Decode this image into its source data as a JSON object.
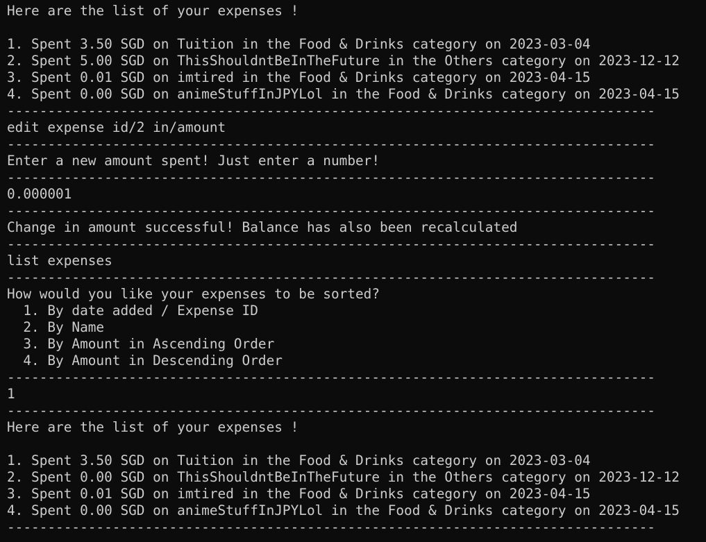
{
  "terminal": {
    "lines": [
      {
        "kind": "output",
        "text": "Here are the list of your expenses !"
      },
      {
        "kind": "blank",
        "text": ""
      },
      {
        "kind": "output",
        "text": "1. Spent 3.50 SGD on Tuition in the Food & Drinks category on 2023-03-04"
      },
      {
        "kind": "output",
        "text": "2. Spent 5.00 SGD on ThisShouldntBeInTheFuture in the Others category on 2023-12-12"
      },
      {
        "kind": "output",
        "text": "3. Spent 0.01 SGD on imtired in the Food & Drinks category on 2023-04-15"
      },
      {
        "kind": "output",
        "text": "4. Spent 0.00 SGD on animeStuffInJPYLol in the Food & Drinks category on 2023-04-15"
      },
      {
        "kind": "separator",
        "text": "--------------------------------------------------------------------------------"
      },
      {
        "kind": "input",
        "text": "edit expense id/2 in/amount"
      },
      {
        "kind": "separator",
        "text": "--------------------------------------------------------------------------------"
      },
      {
        "kind": "output",
        "text": "Enter a new amount spent! Just enter a number!"
      },
      {
        "kind": "separator",
        "text": "--------------------------------------------------------------------------------"
      },
      {
        "kind": "input",
        "text": "0.000001"
      },
      {
        "kind": "separator",
        "text": "--------------------------------------------------------------------------------"
      },
      {
        "kind": "output",
        "text": "Change in amount successful! Balance has also been recalculated"
      },
      {
        "kind": "separator",
        "text": "--------------------------------------------------------------------------------"
      },
      {
        "kind": "input",
        "text": "list expenses"
      },
      {
        "kind": "separator",
        "text": "--------------------------------------------------------------------------------"
      },
      {
        "kind": "output",
        "text": "How would you like your expenses to be sorted?"
      },
      {
        "kind": "output",
        "text": "  1. By date added / Expense ID"
      },
      {
        "kind": "output",
        "text": "  2. By Name"
      },
      {
        "kind": "output",
        "text": "  3. By Amount in Ascending Order"
      },
      {
        "kind": "output",
        "text": "  4. By Amount in Descending Order"
      },
      {
        "kind": "separator",
        "text": "--------------------------------------------------------------------------------"
      },
      {
        "kind": "input",
        "text": "1"
      },
      {
        "kind": "separator",
        "text": "--------------------------------------------------------------------------------"
      },
      {
        "kind": "output",
        "text": "Here are the list of your expenses !"
      },
      {
        "kind": "blank",
        "text": ""
      },
      {
        "kind": "output",
        "text": "1. Spent 3.50 SGD on Tuition in the Food & Drinks category on 2023-03-04"
      },
      {
        "kind": "output",
        "text": "2. Spent 0.00 SGD on ThisShouldntBeInTheFuture in the Others category on 2023-12-12"
      },
      {
        "kind": "output",
        "text": "3. Spent 0.01 SGD on imtired in the Food & Drinks category on 2023-04-15"
      },
      {
        "kind": "output",
        "text": "4. Spent 0.00 SGD on animeStuffInJPYLol in the Food & Drinks category on 2023-04-15"
      },
      {
        "kind": "separator",
        "text": "--------------------------------------------------------------------------------"
      }
    ]
  },
  "colors": {
    "background": "#0c0c0c",
    "foreground": "#cccccc"
  }
}
